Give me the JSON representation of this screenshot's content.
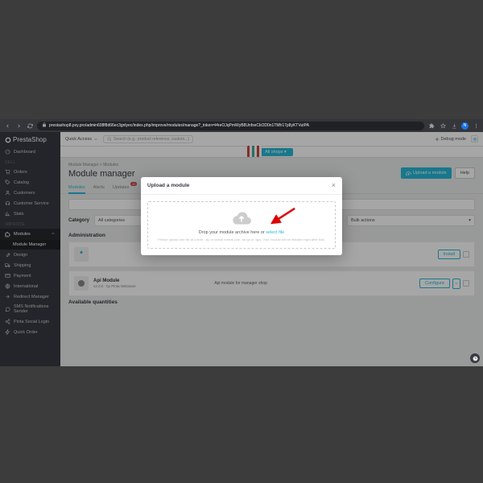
{
  "browser": {
    "url": "prestashop8.pxy.pro/admin608f8d66ec3gnlyec/index.php/improve/modules/manage?_token=l4reOJqPmWyB8UnfxeCkOD0n1TMh17p8yKTVutPA"
  },
  "brand": "PrestaShop",
  "quick_access": "Quick Access",
  "search_placeholder": "Search (e.g.: product reference, custom...)",
  "debug_label": "Debug mode",
  "all_shops": "All shops",
  "sidebar": {
    "dashboard": "Dashboard",
    "sect_sell": "SELL",
    "orders": "Orders",
    "catalog": "Catalog",
    "customers": "Customers",
    "customer_service": "Customer Service",
    "stats": "Stats",
    "sect_improve": "IMPROVE",
    "modules": "Modules",
    "module_manager": "Module Manager",
    "design": "Design",
    "shipping": "Shipping",
    "payment": "Payment",
    "international": "International",
    "redirect": "Redirect Manager",
    "sms": "SMS Notifications Sender",
    "social": "Pinta Social Login",
    "quickorder": "Quick Order"
  },
  "breadcrumb": "Module Manager > Modules",
  "page_title": "Module manager",
  "upload_btn": "Upload a module",
  "help_btn": "Help",
  "tabs": {
    "modules": "Modules",
    "alerts": "Alerts",
    "updates": "Updates",
    "updates_count": "10"
  },
  "category_label": "Category",
  "select_all": "All categories",
  "select_actions": "Bulk actions",
  "sect_admin": "Administration",
  "sect_avail": "Available quantities",
  "mod1": {
    "name": "Api Module",
    "meta": "v2.3.0 · by Pinta Webware",
    "desc": "Api module for manager shop",
    "action": "Configure"
  },
  "mod0": {
    "action": "Install"
  },
  "modal": {
    "title": "Upload a module",
    "drop_text": "Drop your module archive here or ",
    "select": "select file",
    "help": "Please upload one file at a time, .zip or tarball format (.tar, .tar.gz or .tgz). Your module will be installed right after that."
  }
}
